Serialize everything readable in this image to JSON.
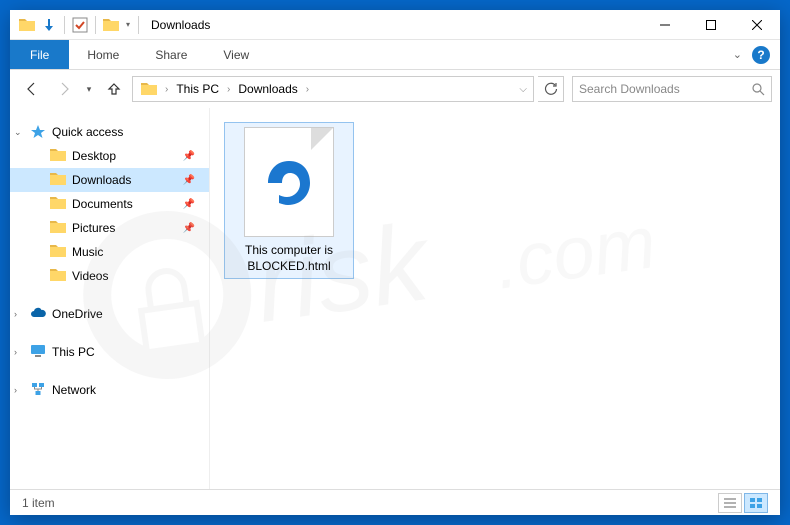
{
  "titlebar": {
    "title": "Downloads"
  },
  "ribbon": {
    "file": "File",
    "tabs": [
      "Home",
      "Share",
      "View"
    ]
  },
  "breadcrumb": {
    "items": [
      "This PC",
      "Downloads"
    ]
  },
  "search": {
    "placeholder": "Search Downloads"
  },
  "sidebar": {
    "quick_access": {
      "label": "Quick access",
      "items": [
        {
          "label": "Desktop",
          "pinned": true
        },
        {
          "label": "Downloads",
          "pinned": true,
          "selected": true
        },
        {
          "label": "Documents",
          "pinned": true
        },
        {
          "label": "Pictures",
          "pinned": true
        },
        {
          "label": "Music",
          "pinned": false
        },
        {
          "label": "Videos",
          "pinned": false
        }
      ]
    },
    "onedrive": {
      "label": "OneDrive"
    },
    "thispc": {
      "label": "This PC"
    },
    "network": {
      "label": "Network"
    }
  },
  "files": [
    {
      "name": "This computer is BLOCKED.html",
      "type": "html",
      "selected": true
    }
  ],
  "statusbar": {
    "count_label": "1 item"
  },
  "colors": {
    "accent": "#1979ca",
    "selection": "#cce8ff"
  }
}
